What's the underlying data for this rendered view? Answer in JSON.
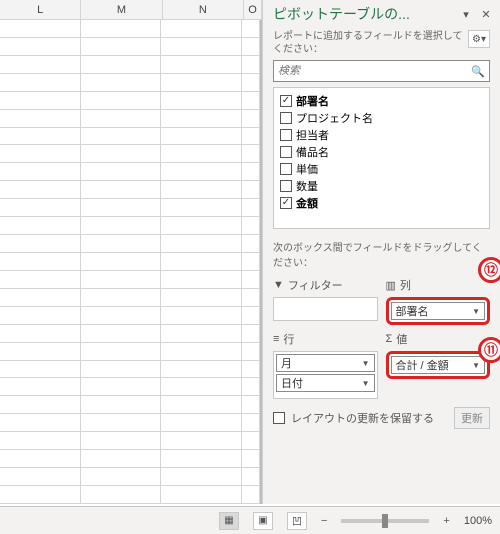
{
  "pane": {
    "title": "ピボットテーブルの...",
    "hint": "レポートに追加するフィールドを選択してください：",
    "search_placeholder": "検索",
    "drag_hint": "次のボックス間でフィールドをドラッグしてください：",
    "fields": [
      {
        "label": "部署名",
        "checked": true,
        "bold": true
      },
      {
        "label": "プロジェクト名",
        "checked": false
      },
      {
        "label": "担当者",
        "checked": false
      },
      {
        "label": "備品名",
        "checked": false
      },
      {
        "label": "単価",
        "checked": false
      },
      {
        "label": "数量",
        "checked": false
      },
      {
        "label": "金額",
        "checked": true,
        "bold": true
      }
    ],
    "areas": {
      "filter": {
        "label": "フィルター"
      },
      "columns": {
        "label": "列",
        "items": [
          "部署名"
        ]
      },
      "rows": {
        "label": "行",
        "items": [
          "月",
          "日付"
        ]
      },
      "values": {
        "label": "値",
        "items": [
          "合計 / 金額"
        ]
      }
    },
    "defer": {
      "label": "レイアウトの更新を保留する",
      "button": "更新"
    }
  },
  "sheet": {
    "columns": [
      "L",
      "M",
      "N",
      "O"
    ]
  },
  "status": {
    "zoom": "100%"
  },
  "callouts": {
    "c11": "⑪",
    "c12": "⑫"
  }
}
